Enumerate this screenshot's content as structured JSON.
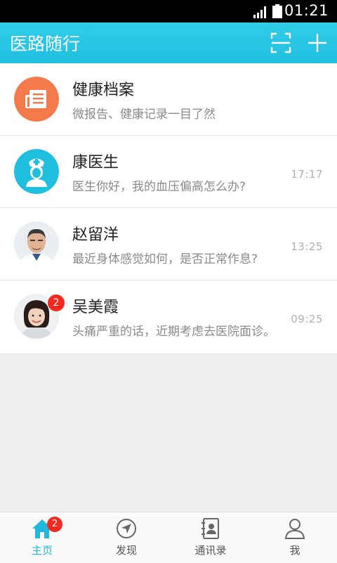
{
  "status_bar": {
    "time": "01:21"
  },
  "app_bar": {
    "title": "医路随行"
  },
  "colors": {
    "accent": "#1fbfdf",
    "badge": "#f5291e",
    "archive_icon": "#f47a4c"
  },
  "conversations": [
    {
      "name": "健康档案",
      "message": "微报告、健康记录一目了然",
      "time": "",
      "icon": "archive-icon"
    },
    {
      "name": "康医生",
      "message": "医生你好，我的血压偏高怎么办?",
      "time": "17:17",
      "icon": "nurse-icon"
    },
    {
      "name": "赵留洋",
      "message": "最近身体感觉如何，是否正常作息?",
      "time": "13:25",
      "icon": "male-doctor-avatar"
    },
    {
      "name": "吴美霞",
      "message": "头痛严重的话，近期考虑去医院面诊。",
      "time": "09:25",
      "badge": "2",
      "icon": "female-avatar"
    }
  ],
  "tab_bar": {
    "home": {
      "label": "主页",
      "badge": "2",
      "active": true
    },
    "discover": {
      "label": "发现"
    },
    "contacts": {
      "label": "通讯录"
    },
    "me": {
      "label": "我"
    }
  }
}
